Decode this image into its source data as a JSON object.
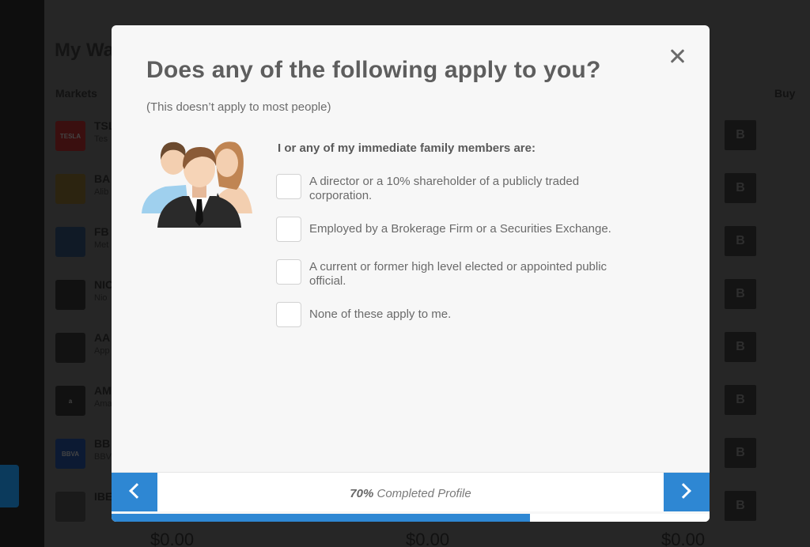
{
  "background": {
    "title": "My Wa",
    "markets_header": "Markets",
    "buy_header": "Buy",
    "rows": [
      {
        "symbol": "TSL",
        "name": "Tes",
        "logo": "TESLA",
        "buy_label": "B"
      },
      {
        "symbol": "BA",
        "name": "Alib",
        "logo": "",
        "buy_label": "B"
      },
      {
        "symbol": "FB",
        "name": "Met",
        "logo": "",
        "buy_label": "B"
      },
      {
        "symbol": "NIO",
        "name": "Nio",
        "logo": "",
        "buy_label": "B"
      },
      {
        "symbol": "AA",
        "name": "App",
        "logo": "",
        "buy_label": "B"
      },
      {
        "symbol": "AM",
        "name": "Ama",
        "logo": "a",
        "buy_label": "B"
      },
      {
        "symbol": "BB",
        "name": "BBV",
        "logo": "BBVA",
        "buy_label": "B"
      },
      {
        "symbol": "IBE",
        "name": "",
        "logo": "",
        "buy_label": "B"
      }
    ],
    "prices": [
      "$0.00",
      "$0.00",
      "$0.00"
    ]
  },
  "modal": {
    "title": "Does any of the following apply to you?",
    "subtitle": "(This doesn’t apply to most people)",
    "question": "I or any of my immediate family members are:",
    "options": [
      {
        "label": "A director or a 10% shareholder of a publicly traded corporation.",
        "checked": false
      },
      {
        "label": "Employed by a Brokerage Firm or a Securities Exchange.",
        "checked": false
      },
      {
        "label": "A current or former high level elected or appointed public official.",
        "checked": false
      },
      {
        "label": "None of these apply to me.",
        "checked": false
      }
    ],
    "footer": {
      "progress_percent": "70%",
      "progress_label": "Completed Profile",
      "progress_fraction": 0.7
    }
  },
  "colors": {
    "accent": "#2e87d3",
    "modal_bg": "#f7f7f7",
    "overlay": "#262626"
  }
}
